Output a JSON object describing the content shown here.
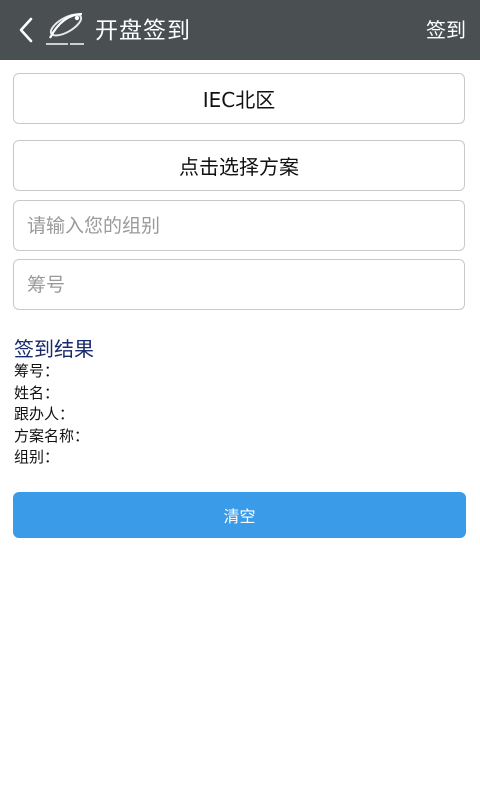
{
  "header": {
    "title": "开盘签到",
    "action_label": "签到",
    "back_icon": "chevron-left-icon",
    "logo_icon": "brand-logo-icon"
  },
  "form": {
    "region_value": "IEC北区",
    "plan_label": "点击选择方案",
    "group_placeholder": "请输入您的组别",
    "number_placeholder": "筹号"
  },
  "result": {
    "title": "签到结果",
    "fields": {
      "number": "筹号：",
      "name": "姓名：",
      "follower": "跟办人：",
      "plan_name": "方案名称：",
      "group": "组别："
    }
  },
  "clear_label": "清空",
  "colors": {
    "topbar": "#4a4f51",
    "accent": "#3a9be8",
    "result_title": "#1a2a6e"
  }
}
